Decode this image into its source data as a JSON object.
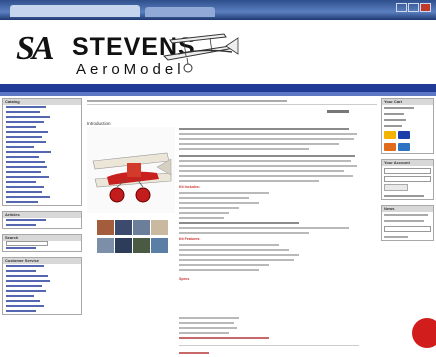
{
  "brand": {
    "initials": "SA",
    "name": "STEVENS",
    "sub": "AeroModel"
  },
  "colors": {
    "nav": "#203c96",
    "accent": "#c33"
  },
  "sidebar": {
    "boxes": [
      {
        "title": "Catalog",
        "items": [
          "",
          "",
          "",
          "",
          "",
          "",
          "",
          "",
          "",
          "",
          "",
          "",
          "",
          "",
          "",
          "",
          "",
          "",
          "",
          "",
          "",
          "",
          ""
        ]
      },
      {
        "title": "Articles",
        "items": [
          "",
          ""
        ]
      },
      {
        "title": "Search",
        "items": [
          "",
          ""
        ]
      },
      {
        "title": "Customer Service",
        "items": [
          "",
          "",
          "",
          "",
          "",
          "",
          "",
          "",
          "",
          ""
        ]
      }
    ]
  },
  "main": {
    "title": "Introduction",
    "section1": "Kit Includes:",
    "section2": "Kit Features:",
    "section3": "Specs"
  },
  "right": {
    "cart_title": "Your Cart",
    "box2_title": "Your Account",
    "box3_title": "News"
  }
}
